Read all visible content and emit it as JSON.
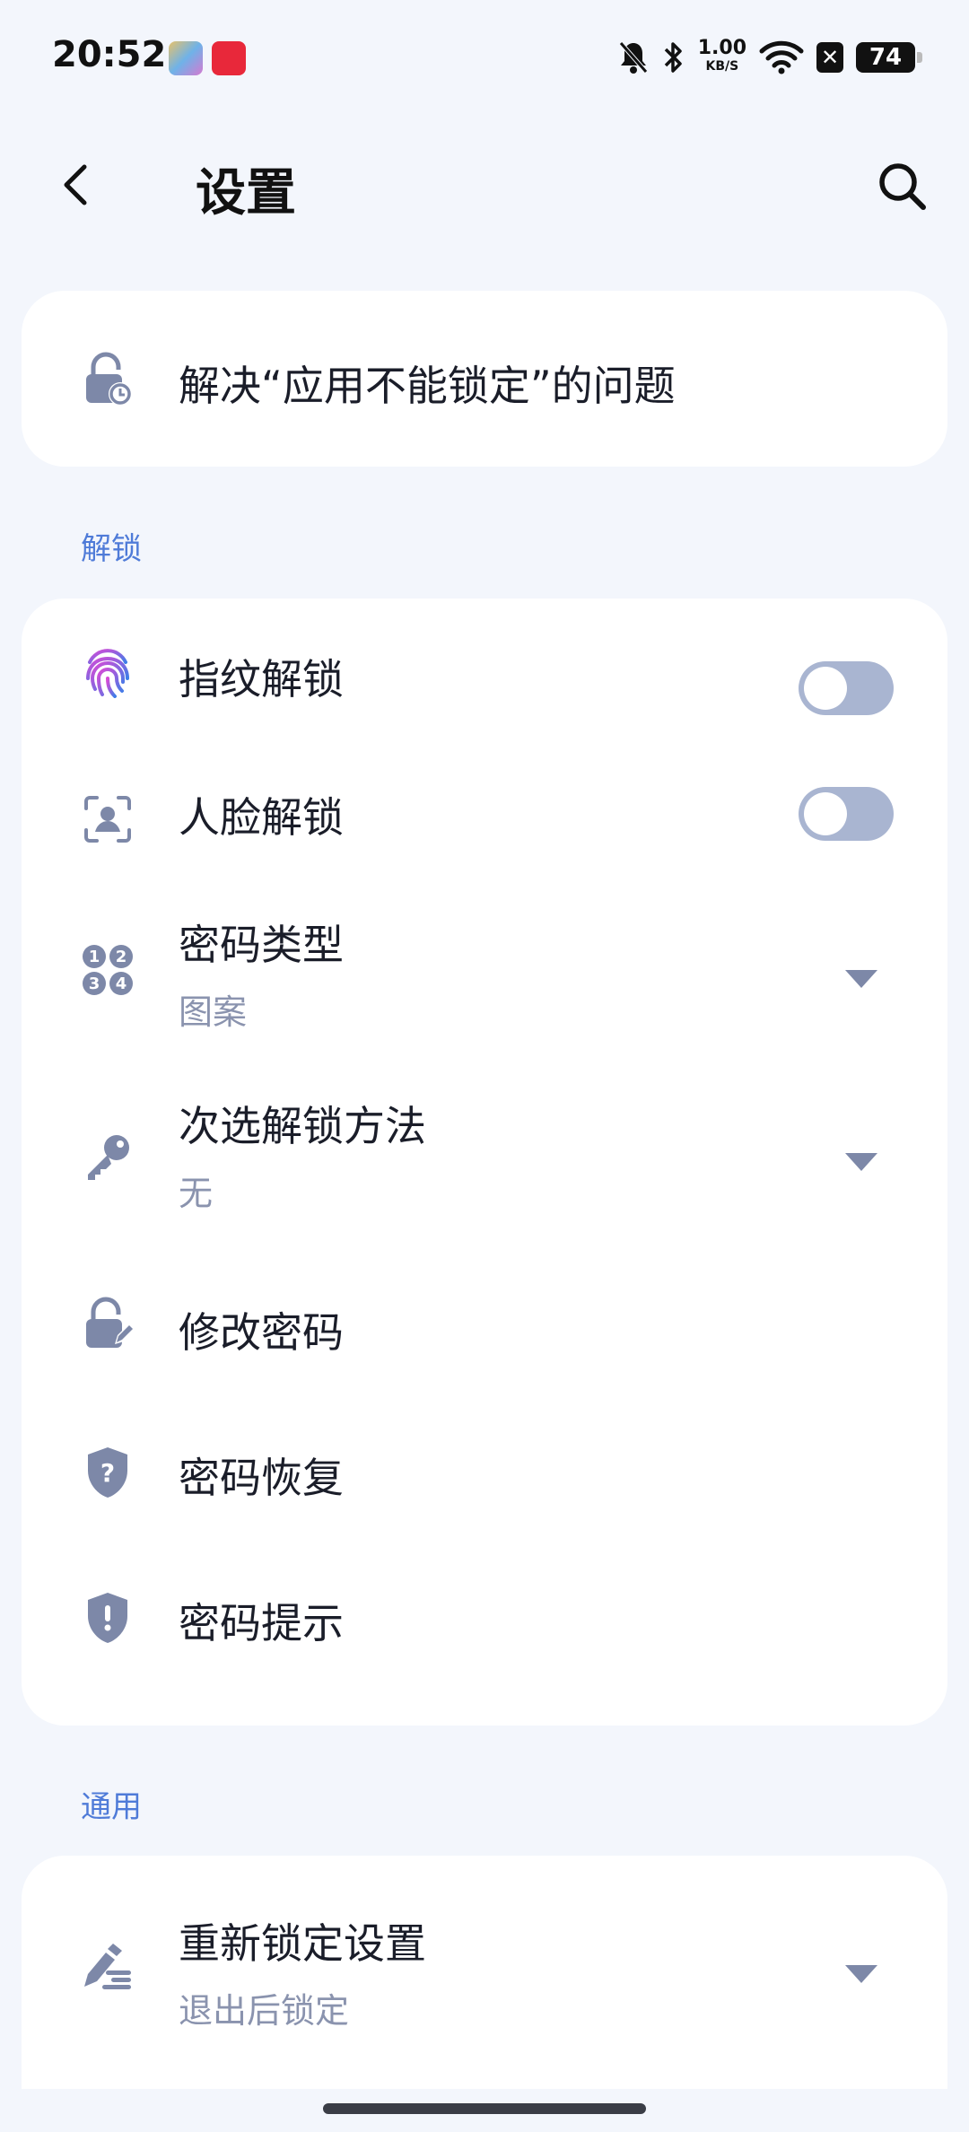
{
  "status_bar": {
    "time": "20:52",
    "net_speed_value": "1.00",
    "net_speed_unit": "KB/S",
    "battery": "74"
  },
  "header": {
    "title": "设置"
  },
  "top_card": {
    "label": "解决“应用不能锁定”的问题"
  },
  "sections": {
    "unlock": {
      "header": "解锁",
      "fingerprint": "指纹解锁",
      "face": "人脸解锁",
      "password_type": {
        "title": "密码类型",
        "value": "图案"
      },
      "secondary_unlock": {
        "title": "次选解锁方法",
        "value": "无"
      },
      "change_password": "修改密码",
      "password_recovery": "密码恢复",
      "password_hint": "密码提示"
    },
    "general": {
      "header": "通用",
      "relock": {
        "title": "重新锁定设置",
        "value": "退出后锁定"
      }
    }
  },
  "toggles": {
    "fingerprint": false,
    "face": false
  },
  "colors": {
    "background": "#f3f6fc",
    "accent": "#4f7bd8",
    "icon": "#7d88a8",
    "toggle_off": "#a9b5d1"
  }
}
